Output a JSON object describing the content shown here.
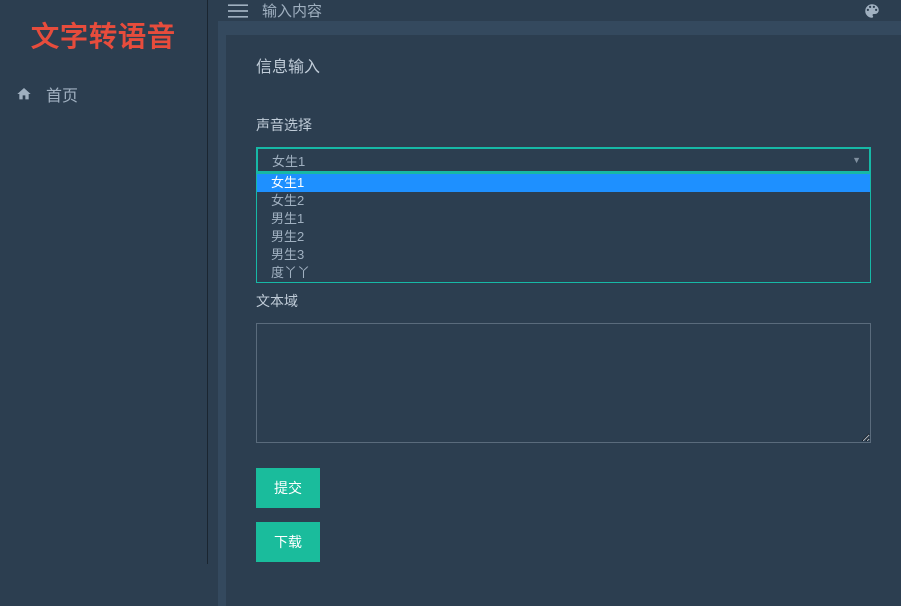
{
  "logo": "文字转语音",
  "sidebar": {
    "items": [
      {
        "label": "首页"
      }
    ]
  },
  "topbar": {
    "breadcrumb": "输入内容"
  },
  "panel": {
    "title": "信息输入",
    "voice_label": "声音选择",
    "voice_selected": "女生1",
    "voice_options": [
      "女生1",
      "女生2",
      "男生1",
      "男生2",
      "男生3",
      "度丫丫"
    ],
    "textarea_label": "文本域",
    "textarea_value": "",
    "submit_label": "提交",
    "download_label": "下载"
  }
}
